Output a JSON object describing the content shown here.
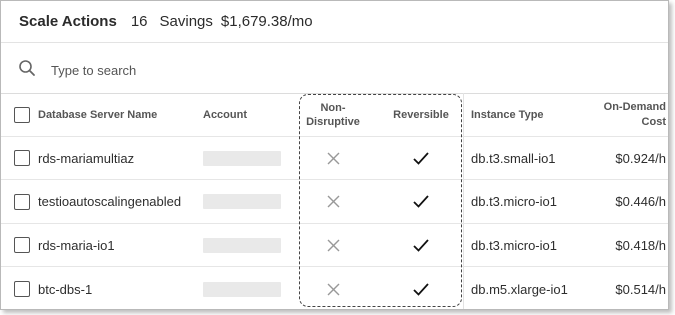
{
  "header": {
    "title": "Scale Actions",
    "count": "16",
    "savings_label": "Savings",
    "savings_value": "$1,679.38/mo"
  },
  "search": {
    "placeholder": "Type to search",
    "icon": "search-icon"
  },
  "table": {
    "columns": {
      "name": "Database Server Name",
      "account": "Account",
      "non_disruptive": "Non-\nDisruptive",
      "reversible": "Reversible",
      "instance_type": "Instance Type",
      "cost": "On-Demand\nCost"
    },
    "rows": [
      {
        "name": "rds-mariamultiaz",
        "non_disruptive": "x",
        "reversible": "check",
        "instance_type": "db.t3.small-io1",
        "cost": "$0.924/h"
      },
      {
        "name": "testioautoscalingenabled",
        "non_disruptive": "x",
        "reversible": "check",
        "instance_type": "db.t3.micro-io1",
        "cost": "$0.446/h"
      },
      {
        "name": "rds-maria-io1",
        "non_disruptive": "x",
        "reversible": "check",
        "instance_type": "db.t3.micro-io1",
        "cost": "$0.418/h"
      },
      {
        "name": "btc-dbs-1",
        "non_disruptive": "x",
        "reversible": "check",
        "instance_type": "db.m5.xlarge-io1",
        "cost": "$0.514/h"
      }
    ]
  }
}
